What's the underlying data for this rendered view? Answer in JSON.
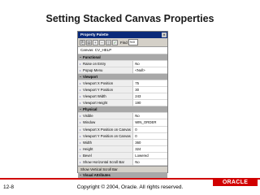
{
  "slide": {
    "title": "Setting Stacked Canvas Properties",
    "page_number": "12-8",
    "copyright": "Copyright © 2004, Oracle.  All rights reserved.",
    "logo_text": "ORACLE",
    "accent_color": "#d10000"
  },
  "palette": {
    "window_title": "Property Palette",
    "close_glyph": "×",
    "toolbar": {
      "find_label": "Find",
      "find_value": "%/X"
    },
    "canvas_name": "Canvas: CV_HELP",
    "rows": [
      {
        "type": "section",
        "label": "Functional"
      },
      {
        "type": "prop",
        "label": "Raise on Entry",
        "value": "No"
      },
      {
        "type": "prop",
        "label": "Popup Menu",
        "value": "<Null>"
      },
      {
        "type": "section",
        "label": "Viewport"
      },
      {
        "type": "prop",
        "label": "Viewport X Position",
        "value": "75"
      },
      {
        "type": "prop",
        "label": "Viewport Y Position",
        "value": "30"
      },
      {
        "type": "prop",
        "label": "Viewport Width",
        "value": "243"
      },
      {
        "type": "prop",
        "label": "Viewport Height",
        "value": "190"
      },
      {
        "type": "section",
        "label": "Physical"
      },
      {
        "type": "prop",
        "label": "Visible",
        "value": "No"
      },
      {
        "type": "prop",
        "label": "Window",
        "value": "WIN_ORDER"
      },
      {
        "type": "prop",
        "label": "Viewport X Position on Canvas",
        "value": "0"
      },
      {
        "type": "prop",
        "label": "Viewport Y Position on Canvas",
        "value": "0"
      },
      {
        "type": "prop",
        "label": "Width",
        "value": "360"
      },
      {
        "type": "prop",
        "label": "Height",
        "value": "324"
      },
      {
        "type": "prop",
        "label": "Bevel",
        "value": "Lowered"
      },
      {
        "type": "prop",
        "label": "Show Horizontal Scroll Bar",
        "value": "No"
      },
      {
        "type": "prop",
        "label": "Show Vertical Scroll Bar",
        "value": "No"
      },
      {
        "type": "section",
        "label": "Visual Attributes"
      }
    ],
    "status_text": "Show Vertical Scroll Bar"
  }
}
